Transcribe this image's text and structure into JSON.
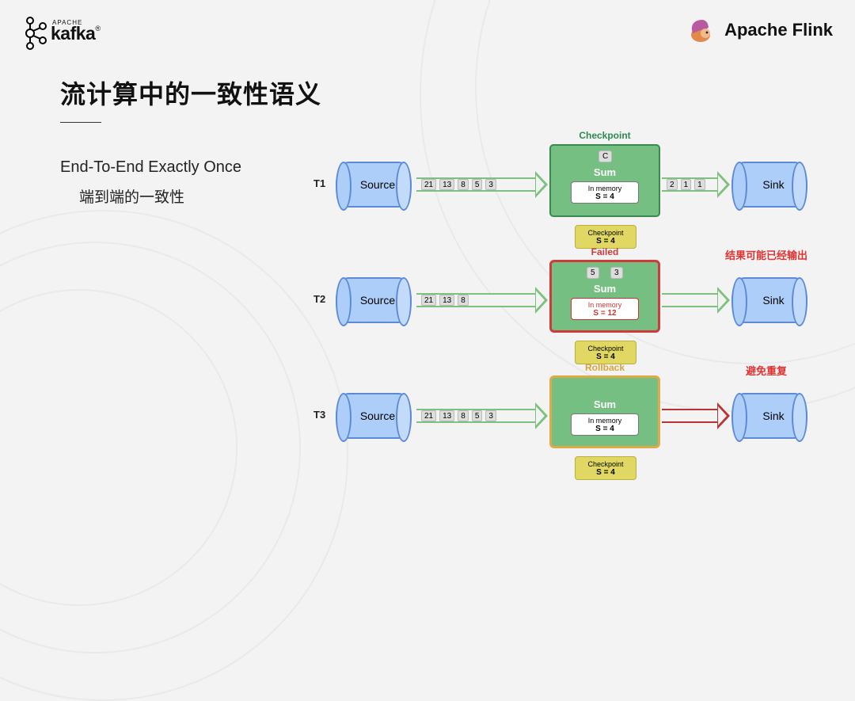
{
  "logos": {
    "kafka_small": "APACHE",
    "kafka": "kafka",
    "kafka_tm": "®",
    "flink": "Apache Flink"
  },
  "title": "流计算中的一致性语义",
  "subtitle_en": "End-To-End Exactly Once",
  "subtitle_cn": "端到端的一致性",
  "rows": [
    {
      "t": "T1",
      "source": "Source",
      "sink": "Sink",
      "stream_in": [
        "21",
        "13",
        "8",
        "5",
        "3"
      ],
      "stream_out": [
        "2",
        "1",
        "1"
      ],
      "header": "Checkpoint",
      "header_color": "#2a8a4f",
      "chip": "C",
      "sum_label": "Sum",
      "mem_label": "In memory",
      "mem_value": "S = 4",
      "ckpt_label": "Checkpoint",
      "ckpt_value": "S = 4"
    },
    {
      "t": "T2",
      "source": "Source",
      "sink": "Sink",
      "stream_in": [
        "21",
        "13",
        "8"
      ],
      "header": "Failed",
      "header_color": "#cf3a3a",
      "chips": [
        "5",
        "3"
      ],
      "sum_label": "Sum",
      "mem_label": "In memory",
      "mem_value": "S = 12",
      "ckpt_label": "Checkpoint",
      "ckpt_value": "S = 4",
      "note": "结果可能已经输出"
    },
    {
      "t": "T3",
      "source": "Source",
      "sink": "Sink",
      "stream_in": [
        "21",
        "13",
        "8",
        "5",
        "3"
      ],
      "header": "Rollback",
      "header_color": "#d7a23a",
      "sum_label": "Sum",
      "mem_label": "In memory",
      "mem_value": "S = 4",
      "ckpt_label": "Checkpoint",
      "ckpt_value": "S = 4",
      "note": "避免重复"
    }
  ]
}
